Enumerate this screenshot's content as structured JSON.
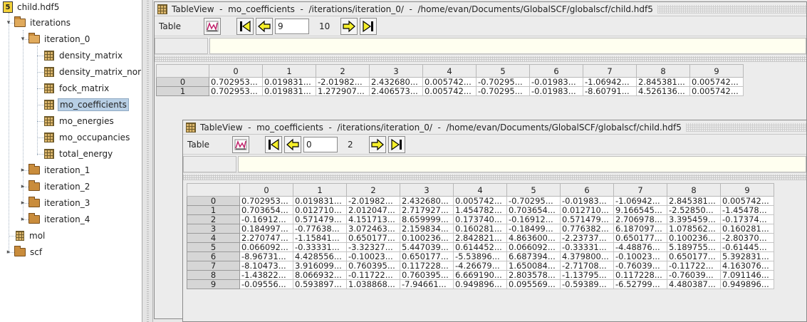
{
  "tree": {
    "root": "child.hdf5",
    "nodes": [
      {
        "label": "iterations"
      },
      {
        "label": "iteration_0"
      },
      {
        "label": "density_matrix"
      },
      {
        "label": "density_matrix_nor"
      },
      {
        "label": "fock_matrix"
      },
      {
        "label": "mo_coefficients"
      },
      {
        "label": "mo_energies"
      },
      {
        "label": "mo_occupancies"
      },
      {
        "label": "total_energy"
      },
      {
        "label": "iteration_1"
      },
      {
        "label": "iteration_2"
      },
      {
        "label": "iteration_3"
      },
      {
        "label": "iteration_4"
      },
      {
        "label": "mol"
      },
      {
        "label": "scf"
      }
    ]
  },
  "frame1": {
    "title": "TableView  -  mo_coefficients  -  /iterations/iteration_0/  -  /home/evan/Documents/GlobalSCF/globalscf/child.hdf5",
    "menu_table": "Table",
    "page_value": "9",
    "page_count": "10",
    "columns": [
      "0",
      "1",
      "2",
      "3",
      "4",
      "5",
      "6",
      "7",
      "8",
      "9"
    ],
    "rows": [
      {
        "h": "0",
        "cells": [
          "0.702953...",
          "0.019831...",
          "-2.01982...",
          "2.432680...",
          "0.005742...",
          "-0.70295...",
          "-0.01983...",
          "-1.06942...",
          "2.845381...",
          "0.005742..."
        ]
      },
      {
        "h": "1",
        "cells": [
          "0.702953...",
          "0.019831...",
          "1.272907...",
          "2.406573...",
          "0.005742...",
          "-0.70295...",
          "-0.01983...",
          "-8.60791...",
          "4.526136...",
          "0.005742..."
        ]
      }
    ]
  },
  "frame2": {
    "title": "TableView  -  mo_coefficients  -  /iterations/iteration_0/  -  /home/evan/Documents/GlobalSCF/globalscf/child.hdf5",
    "menu_table": "Table",
    "page_value": "0",
    "page_count": "2",
    "columns": [
      "0",
      "1",
      "2",
      "3",
      "4",
      "5",
      "6",
      "7",
      "8",
      "9"
    ],
    "rows": [
      {
        "h": "0",
        "cells": [
          "0.702953...",
          "0.019831...",
          "-2.01982...",
          "2.432680...",
          "0.005742...",
          "-0.70295...",
          "-0.01983...",
          "-1.06942...",
          "2.845381...",
          "0.005742..."
        ]
      },
      {
        "h": "1",
        "cells": [
          "0.703654...",
          "0.012710...",
          "2.012047...",
          "2.717927...",
          "1.454782...",
          "0.703654...",
          "0.012710...",
          "9.166545...",
          "-2.52850...",
          "-1.45478..."
        ]
      },
      {
        "h": "2",
        "cells": [
          "-0.16912...",
          "0.571479...",
          "4.151713...",
          "8.659999...",
          "0.173740...",
          "-0.16912...",
          "0.571479...",
          "2.706978...",
          "3.395459...",
          "-0.17374..."
        ]
      },
      {
        "h": "3",
        "cells": [
          "0.184997...",
          "-0.77638...",
          "3.072463...",
          "2.159834...",
          "0.160281...",
          "-0.18499...",
          "0.776382...",
          "6.187097...",
          "1.078562...",
          "0.160281..."
        ]
      },
      {
        "h": "4",
        "cells": [
          "2.270747...",
          "-1.15841...",
          "0.650177...",
          "0.100236...",
          "2.842821...",
          "4.863600...",
          "-2.23737...",
          "0.650177...",
          "0.100236...",
          "-2.80370..."
        ]
      },
      {
        "h": "5",
        "cells": [
          "0.066092...",
          "-0.33331...",
          "-3.32327...",
          "5.447039...",
          "0.614452...",
          "0.066092...",
          "-0.33331...",
          "-4.48876...",
          "5.189755...",
          "-0.61445..."
        ]
      },
      {
        "h": "6",
        "cells": [
          "-8.96731...",
          "4.428556...",
          "-0.10023...",
          "0.650177...",
          "-5.53896...",
          "6.687394...",
          "4.379800...",
          "-0.10023...",
          "0.650177...",
          "5.392831..."
        ]
      },
      {
        "h": "7",
        "cells": [
          "-8.10473...",
          "3.916099...",
          "0.760395...",
          "0.117228...",
          "-4.26679...",
          "1.650084...",
          "-2.71708...",
          "-0.76039...",
          "-0.11722...",
          "4.163076..."
        ]
      },
      {
        "h": "8",
        "cells": [
          "-1.43822...",
          "8.066932...",
          "-0.11722...",
          "0.760395...",
          "6.669190...",
          "2.803578...",
          "-1.13795...",
          "0.117228...",
          "-0.76039...",
          "7.091146..."
        ]
      },
      {
        "h": "9",
        "cells": [
          "-0.09556...",
          "0.593897...",
          "1.038868...",
          "-7.94661...",
          "0.949896...",
          "0.095569...",
          "-0.59389...",
          "-6.52799...",
          "4.480387...",
          "0.949896..."
        ]
      }
    ]
  },
  "colors": {
    "selection": "#b8cfe5",
    "cell_editor_bg": "#fffff0",
    "arrow_yellow": "#f5ef2a"
  },
  "icons": {
    "first": "first-page-icon",
    "prev": "previous-page-icon",
    "next": "next-page-icon",
    "last": "last-page-icon",
    "chart": "line-plot-icon"
  }
}
